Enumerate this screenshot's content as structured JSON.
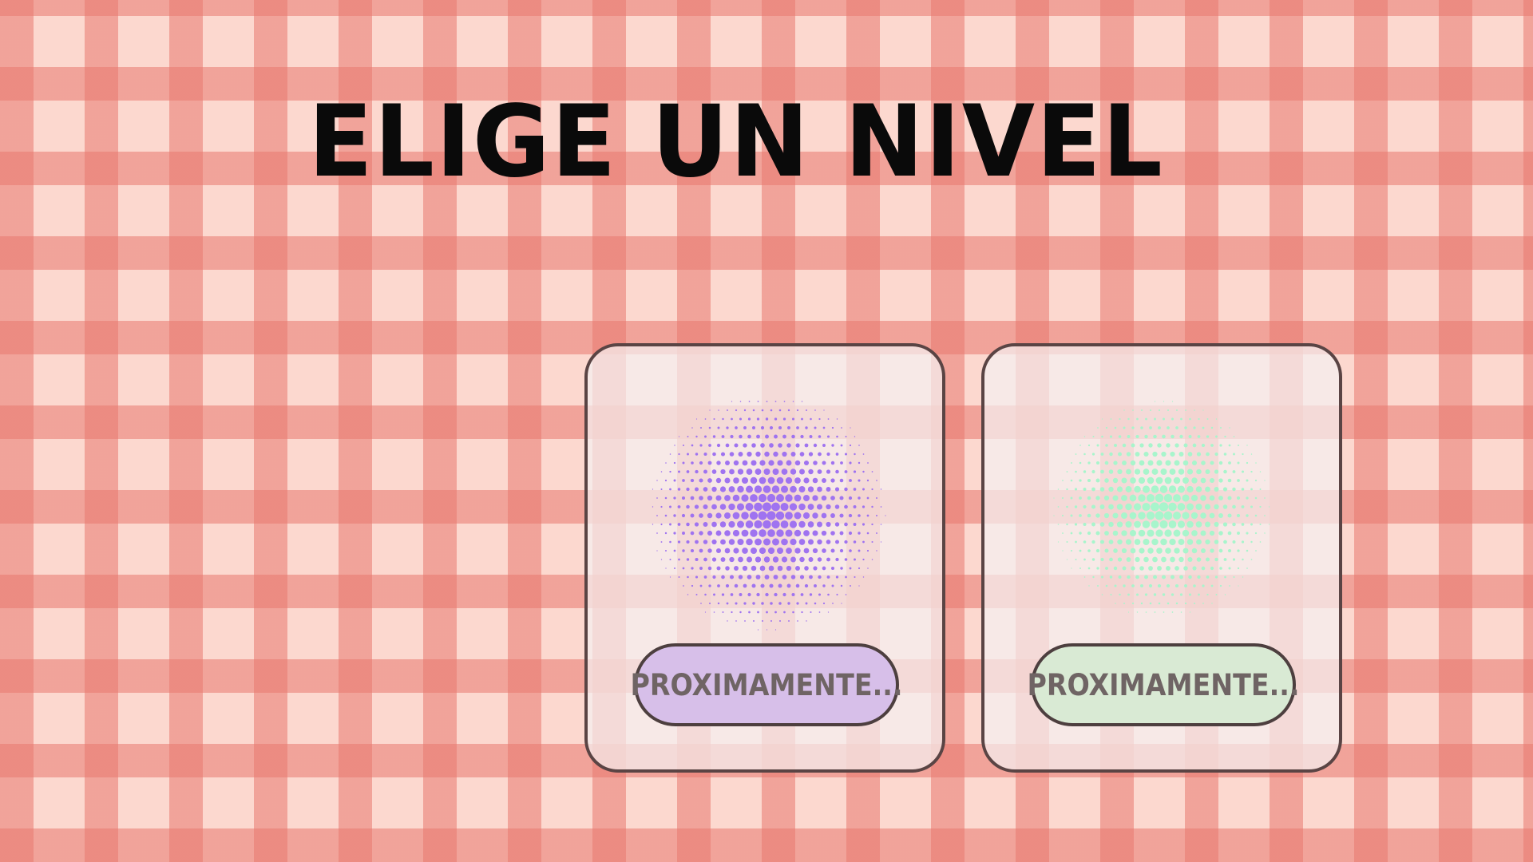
{
  "screen": {
    "title": "ELIGE UN NIVEL"
  },
  "levels": [
    {
      "label": "PROXIMAMENTE...",
      "accent_color": "#9f73f0",
      "button_color": "#d7bfe9",
      "icon": "purple-halftone-dots"
    },
    {
      "label": "PROXIMAMENTE...",
      "accent_color": "#a8f5cc",
      "button_color": "#d9ead4",
      "icon": "green-halftone-dots"
    }
  ],
  "colors": {
    "background": "#fcd8cf",
    "stripe": "#e8786e",
    "title": "#0a0a0a",
    "card_border": "#5a4444"
  }
}
